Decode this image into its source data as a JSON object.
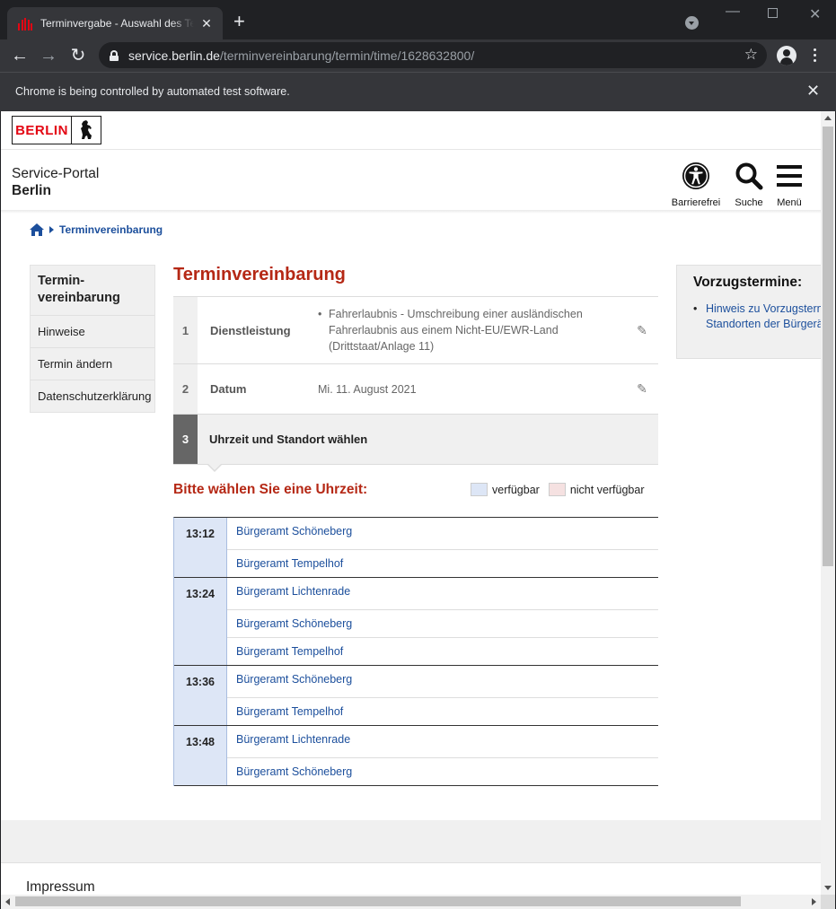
{
  "browser": {
    "tab_title": "Terminvergabe - Auswahl des Termins",
    "url_host": "service.berlin.de",
    "url_path": "/terminvereinbarung/termin/time/1628632800/",
    "infobar_text": "Chrome is being controlled by automated test software."
  },
  "header": {
    "logo_text": "BERLIN",
    "portal_line1": "Service-Portal",
    "portal_line2": "Berlin",
    "tools": [
      {
        "label": "Barrierefrei",
        "icon": "accessibility-icon"
      },
      {
        "label": "Suche",
        "icon": "search-icon"
      },
      {
        "label": "Menü",
        "icon": "menu-icon"
      }
    ]
  },
  "breadcrumb": {
    "current": "Terminvereinbarung"
  },
  "sidenav": {
    "items": [
      {
        "label": "Termin-\nvereinbarung",
        "active": true
      },
      {
        "label": "Hinweise"
      },
      {
        "label": "Termin ändern"
      },
      {
        "label": "Datenschutzerklärung"
      }
    ]
  },
  "main": {
    "title": "Terminvereinbarung",
    "steps": [
      {
        "num": "1",
        "label": "Dienstleistung",
        "value": "Fahrerlaubnis - Umschreibung einer ausländischen Fahrerlaubnis aus einem Nicht-EU/EWR-Land (Drittstaat/Anlage 11)"
      },
      {
        "num": "2",
        "label": "Datum",
        "value": "Mi. 11. August 2021"
      },
      {
        "num": "3",
        "label": "Uhrzeit und Standort wählen"
      }
    ],
    "pick_title": "Bitte wählen Sie eine Uhrzeit:",
    "legend": {
      "available": "verfügbar",
      "unavailable": "nicht verfügbar"
    },
    "slots": [
      {
        "time": "13:12",
        "locations": [
          "Bürgeramt Schöneberg",
          "Bürgeramt Tempelhof"
        ]
      },
      {
        "time": "13:24",
        "locations": [
          "Bürgeramt Lichtenrade",
          "Bürgeramt Schöneberg",
          "Bürgeramt Tempelhof"
        ]
      },
      {
        "time": "13:36",
        "locations": [
          "Bürgeramt Schöneberg",
          "Bürgeramt Tempelhof"
        ]
      },
      {
        "time": "13:48",
        "locations": [
          "Bürgeramt Lichtenrade",
          "Bürgeramt Schöneberg"
        ]
      }
    ]
  },
  "aside": {
    "title": "Vorzugstermine:",
    "link": "Hinweis zu Vorzugsterminen an\nStandorten der Bürgerämter"
  },
  "footer": {
    "impressum": "Impressum"
  },
  "colors": {
    "brand_red": "#e30613",
    "title_red": "#b52815",
    "link_blue": "#1c4f9c",
    "available": "#dde6f6",
    "unavailable": "#f5e1e1"
  }
}
